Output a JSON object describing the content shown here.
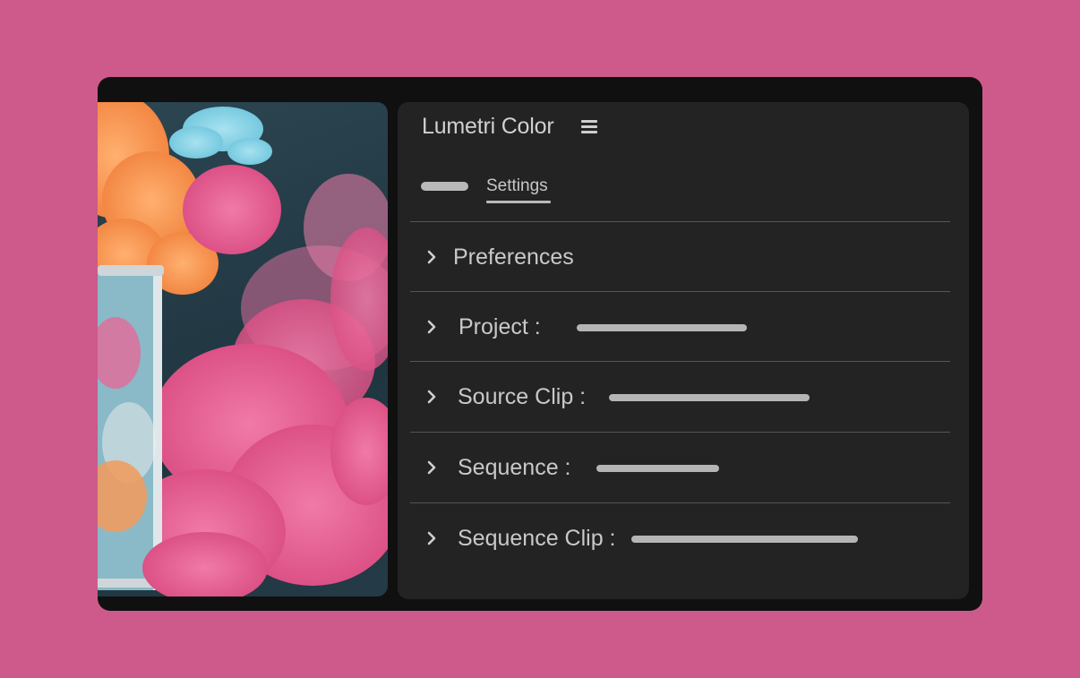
{
  "panel": {
    "title": "Lumetri Color",
    "menu_icon": "hamburger-menu-icon",
    "tabs": [
      {
        "label": "",
        "type": "placeholder-pill"
      },
      {
        "label": "Settings",
        "active": true
      }
    ]
  },
  "sections": [
    {
      "label": "Preferences",
      "icon": "chevron-right-icon"
    },
    {
      "label": "Project :",
      "icon": "chevron-right-icon"
    },
    {
      "label": "Source Clip :",
      "icon": "chevron-right-icon"
    },
    {
      "label": "Sequence :",
      "icon": "chevron-right-icon"
    },
    {
      "label": "Sequence Clip :",
      "icon": "chevron-right-icon"
    }
  ],
  "colors": {
    "background": "#cd5a8a",
    "frame": "#101010",
    "panel": "#232323",
    "text": "#c9c9c9"
  }
}
